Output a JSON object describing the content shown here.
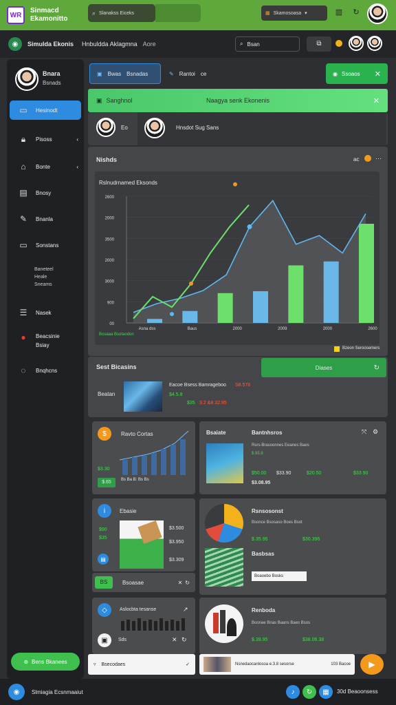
{
  "topbar": {
    "logo_text": "WR",
    "title_line1": "Sinmacd",
    "title_line2": "Ekamonitto",
    "search_text": "Slanakss Eiceks",
    "button_text": "Skamosoasa"
  },
  "subbar": {
    "name": "Simulda Ekonis",
    "crumb": "Hnbuldda Aklagmna",
    "crumb2": "Aore",
    "search": "Bsan"
  },
  "sidebar": {
    "user_name": "Bnara",
    "user_sub": "Bsnads",
    "items": [
      {
        "label": "Hesinodt",
        "icon": "dashboard-icon"
      },
      {
        "label": "Pisoss",
        "icon": "lock-icon"
      },
      {
        "label": "Bonte",
        "icon": "home-icon"
      },
      {
        "label": "Bnosy",
        "icon": "calendar-icon"
      },
      {
        "label": "Bnanla",
        "icon": "edit-icon"
      },
      {
        "label": "Sonstans",
        "icon": "screen-icon"
      },
      {
        "label": "Baneteel"
      },
      {
        "label": "Heale"
      },
      {
        "label": "Sneams"
      },
      {
        "label": "Nasek",
        "icon": "list-icon"
      },
      {
        "label": "Beacsinie",
        "icon": "alert-icon"
      },
      {
        "label": "Bsiay"
      },
      {
        "label": "Bnqhcns",
        "icon": "chat-icon"
      }
    ],
    "bottom_button": "Bens Bkanees"
  },
  "tabs": {
    "tab1": "Bwas",
    "tab1b": "Bsnadas",
    "tab2": "Rantoi",
    "tab2b": "ce",
    "green_button": "Ssoaos"
  },
  "banner": {
    "left": "Sanghnol",
    "center": "Naagya senk Ekonenis"
  },
  "people": {
    "label1": "Eo",
    "label2": "Hnsdot Sug Sans"
  },
  "chart_panel": {
    "heading": "Nishds",
    "right": "ac",
    "legend_text": "Bzeon Seroosemers"
  },
  "chart_data": {
    "type": "line",
    "title": "Rslnudrnamed Eksonds",
    "yticks": [
      "2600",
      "2000",
      "3500",
      "2000",
      "3000",
      "900",
      "00"
    ],
    "xticks": [
      "Asna",
      "dss",
      "Baus",
      "2000",
      "2009",
      "2000",
      "2600"
    ],
    "x_labels": [
      "Asna dss",
      "Baus",
      "2000",
      "2009",
      "2000",
      "2600"
    ],
    "bottom_left": "Bosaaa Bsotaodon",
    "line_green": [
      5,
      30,
      18,
      45,
      80,
      110,
      135
    ],
    "line_blue": [
      12,
      22,
      28,
      37,
      55,
      110,
      140,
      90,
      100,
      80,
      125
    ],
    "bars": [
      4,
      12,
      30,
      32,
      58,
      62,
      100
    ]
  },
  "stats": {
    "title": "Sest Bicasins",
    "button": "Diases",
    "row_label": "Beatan",
    "headline": "Eacoe Bsess Bamrageboo",
    "headline_red": "S8.578",
    "values_green": "$4.5.8",
    "values_green2": "$35",
    "values_red": "3.2 &8 32.95"
  },
  "cards": {
    "c1_title": "Ravto Cortas",
    "c1_val1": "$3.30",
    "c1_val2": "$.65",
    "c1_axis": "Bs Ba B: Bs Bs",
    "c2_title": "Bsaiate",
    "c2_sub": "Bantnhsros",
    "c2_line": "Rsrs-Brasoonnes Eeanes Baes",
    "c2_v1": "$.95.8",
    "c2_v2": "$50.00",
    "c2_v3": "$33.90",
    "c2_v4": "$20.50",
    "c2_bottom": "$3.08.95",
    "c3_title": "Ebasie",
    "c3_v1": "$90",
    "c3_v2": "$35",
    "c3_v3": "$3.500",
    "c3_v4": "$3.950",
    "c3_v5": "$3.309",
    "c4_title": "Rsnsosonst",
    "c4_line": "Bsonce Bsosaso Boes Bsot",
    "c4_v1": "$.35.96",
    "c4_v2": "$30.396",
    "c4_sub": "Basbsas",
    "c4_btn": "Boaoebo Bosks",
    "pill_text": "Bsoasae",
    "pill_badge": "BS",
    "c5_title": "Aslocbta tesanse",
    "c5_sub": "Sds",
    "c6_title": "Renboda",
    "c6_line": "Boonae Bnas Baans Baes Bsos",
    "c6_v1": "$.39.95",
    "c6_v2": "$38.06.38"
  },
  "bottom_inputs": {
    "left": "Bsecodaes",
    "mid": "Nsnedaocanlosoa e.3.8 sesorse",
    "mid_right": "103 Bacoe"
  },
  "footer": {
    "left": "Slmiagia Ecsnmaaiut",
    "right": "30d Beaoonsess"
  },
  "colors": {
    "topbar": "#5fa83c",
    "accent_green": "#4fd15a",
    "accent_blue": "#2d8be0",
    "accent_orange": "#f39a1c"
  }
}
